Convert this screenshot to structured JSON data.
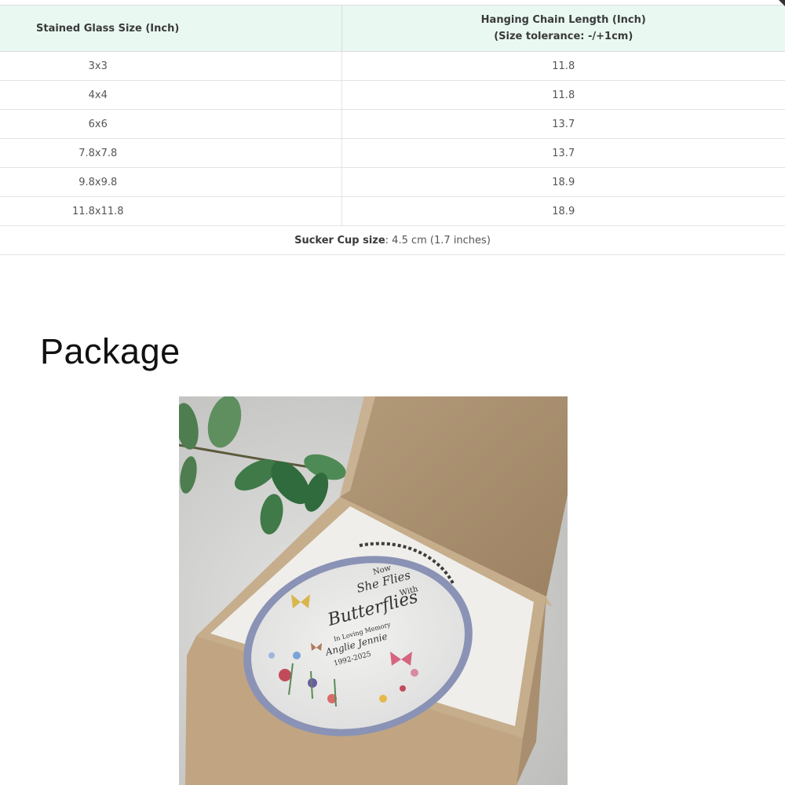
{
  "size_table": {
    "headers": {
      "size": "Stained Glass Size (Inch)",
      "chain_line1": "Hanging Chain Length (Inch)",
      "chain_line2": "(Size tolerance: -/+1cm)"
    },
    "rows": [
      {
        "size": "3x3",
        "chain": "11.8"
      },
      {
        "size": "4x4",
        "chain": "11.8"
      },
      {
        "size": "6x6",
        "chain": "13.7"
      },
      {
        "size": "7.8x7.8",
        "chain": "13.7"
      },
      {
        "size": "9.8x9.8",
        "chain": "18.9"
      },
      {
        "size": "11.8x11.8",
        "chain": "18.9"
      }
    ],
    "note": {
      "label": "Sucker Cup size",
      "value": ": 4.5 cm (1.7 inches)"
    }
  },
  "package_section": {
    "title": "Package"
  },
  "product_image": {
    "texts": {
      "line1": "Now",
      "line2": "She Flies",
      "line3": "With",
      "line4": "Butterflies",
      "line5": "In Loving Memory",
      "line6": "Anglie Jennie",
      "line7": "1992-2025"
    }
  },
  "colors": {
    "header_bg": "#e9f8f1",
    "border": "#e3e3e3",
    "box_cardboard": "#b99f7d",
    "box_lid_inner": "#a88d6c",
    "glass_frame": "#8a93b5"
  }
}
